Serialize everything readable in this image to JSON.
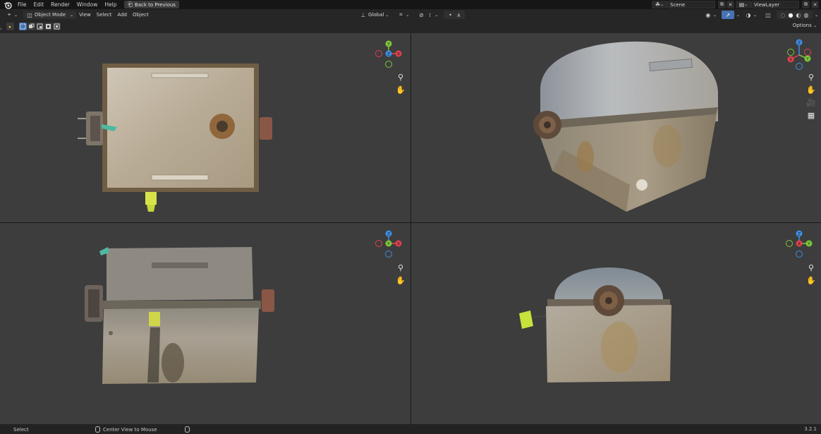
{
  "topbar": {
    "menus": [
      "File",
      "Edit",
      "Render",
      "Window",
      "Help"
    ],
    "back_button": "Back to Previous",
    "scene": "Scene",
    "view_layer": "ViewLayer"
  },
  "header": {
    "mode": "Object Mode",
    "menus": [
      "View",
      "Select",
      "Add",
      "Object"
    ],
    "orientation": "Global",
    "options": "Options"
  },
  "status": {
    "left_action": "Select",
    "middle_action": "Center View to Mouse",
    "version": "3.2.1"
  },
  "colors": {
    "x_axis": "#e0414f",
    "y_axis": "#7dc73a",
    "z_axis": "#3d8ee6",
    "viewport_bg": "#3d3d3d",
    "selection_highlight": "#4772b3"
  },
  "icons": {
    "zoom": "zoom-icon",
    "pan": "hand-icon",
    "camera": "camera-icon",
    "grid": "grid-icon"
  }
}
